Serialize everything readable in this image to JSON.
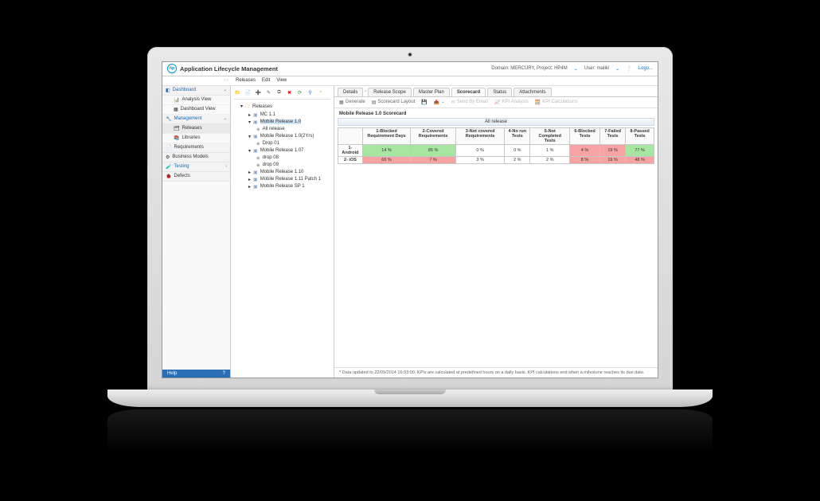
{
  "header": {
    "app_title": "Application Lifecycle Management",
    "domain_label": "Domain: MERCURY, Project: HP4M",
    "user_label": "User: maliki",
    "logout": "Logo..."
  },
  "menubar": {
    "nav_glyphs": "‹    ›",
    "items": [
      "Releases",
      "Edit",
      "View"
    ]
  },
  "sidebar": {
    "groups": [
      {
        "name": "Dashboard",
        "items": [
          "Analysis View",
          "Dashboard View"
        ]
      },
      {
        "name": "Management",
        "items": [
          "Releases",
          "Libraries"
        ]
      }
    ],
    "flat": [
      "Requirements",
      "Business Models"
    ],
    "testing_header": "Testing",
    "defects": "Defects",
    "help": "Help",
    "help_q": "?"
  },
  "tree": {
    "root": "Releases",
    "nodes": {
      "mc": "MC 1.1",
      "sel": "Mobile Release 1.0",
      "all": "All release",
      "r102": "Mobile Release 1.0(2Yrs)",
      "drop01": "Drop 01",
      "r107": "Mobile Release 1.07",
      "drop08": "drop 08",
      "drop09": "drop 09",
      "r110": "Mobile Release 1.10",
      "r111": "Mobile Release 1.11 Patch 1",
      "sp1": "Mobile Release SP 1"
    }
  },
  "tabs": [
    "Details",
    "Release Scope",
    "Master Plan",
    "Scorecard",
    "Status",
    "Attachments"
  ],
  "active_tab": 3,
  "sec_toolbar": {
    "generate": "Generate",
    "layout": "Scorecard Layout",
    "d1": "Send By Email",
    "d2": "KPI Analysis",
    "d3": "KPI Calculations"
  },
  "scorecard": {
    "title": "Mobile Release 1.0 Scorecard",
    "band": "All release",
    "columns": [
      "1-Blocked Requirement Days",
      "2-Covered Requirements",
      "3-Not covered Requirements",
      "4-No run Tests",
      "5-Not Completed Tests",
      "6-Blocked Tests",
      "7-Failed Tests",
      "8-Passed Tests"
    ],
    "rows": [
      {
        "label": "1- Android",
        "cells": [
          {
            "v": "14 %",
            "c": "c-green"
          },
          {
            "v": "85 %",
            "c": "c-green"
          },
          {
            "v": "0 %",
            "c": ""
          },
          {
            "v": "0 %",
            "c": ""
          },
          {
            "v": "1 %",
            "c": ""
          },
          {
            "v": "4 %",
            "c": "c-red"
          },
          {
            "v": "19 %",
            "c": "c-red"
          },
          {
            "v": "77 %",
            "c": "c-green"
          }
        ]
      },
      {
        "label": "2- iOS",
        "cells": [
          {
            "v": "66 %",
            "c": "c-red"
          },
          {
            "v": "7 %",
            "c": "c-red"
          },
          {
            "v": "3 %",
            "c": ""
          },
          {
            "v": "2 %",
            "c": ""
          },
          {
            "v": "2 %",
            "c": ""
          },
          {
            "v": "8 %",
            "c": "c-red"
          },
          {
            "v": "19 %",
            "c": "c-red"
          },
          {
            "v": "48 %",
            "c": "c-red"
          }
        ]
      }
    ]
  },
  "footer": "* Data updated to 22/09/2014 16:03:00. KPIs are calculated at predefined hours on a daily basis. KPI calculations end when a milestone reaches its due date."
}
